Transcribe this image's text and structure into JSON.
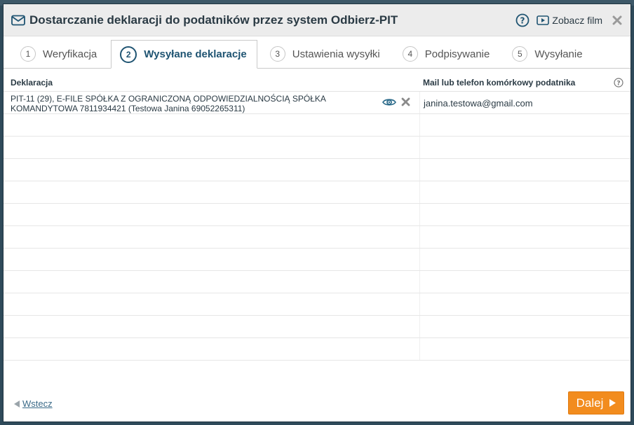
{
  "dialog": {
    "title": "Dostarczanie deklaracji do podatników przez system Odbierz-PIT",
    "film_link": "Zobacz film"
  },
  "tabs": [
    {
      "num": "1",
      "label": "Weryfikacja",
      "active": false
    },
    {
      "num": "2",
      "label": "Wysyłane deklaracje",
      "active": true
    },
    {
      "num": "3",
      "label": "Ustawienia wysyłki",
      "active": false
    },
    {
      "num": "4",
      "label": "Podpisywanie",
      "active": false
    },
    {
      "num": "5",
      "label": "Wysyłanie",
      "active": false
    }
  ],
  "table": {
    "headers": {
      "declaration": "Deklaracja",
      "contact": "Mail lub telefon komórkowy podatnika"
    },
    "rows": [
      {
        "declaration": "PIT-11 (29), E-FILE SPÓŁKA Z OGRANICZONĄ ODPOWIEDZIALNOŚCIĄ SPÓŁKA KOMANDYTOWA 7811934421 (Testowa Janina 69052265311)",
        "contact": "janina.testowa@gmail.com"
      }
    ],
    "empty_rows": 11
  },
  "footer": {
    "back_label": "Wstecz",
    "next_label": "Dalej"
  },
  "colors": {
    "accent": "#1f5472",
    "primary_button": "#f28c1e",
    "link": "#3a6a88"
  }
}
